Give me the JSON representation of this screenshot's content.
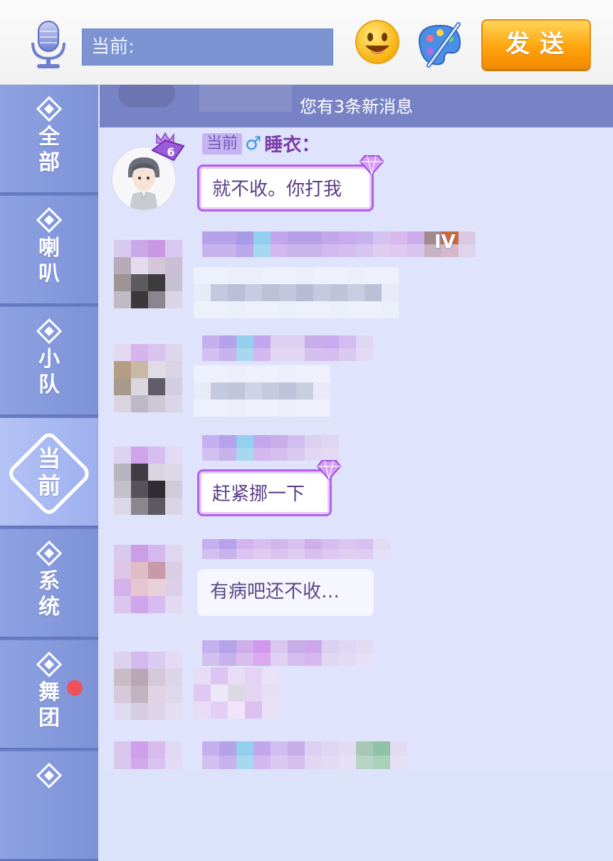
{
  "topbar": {
    "input_prefix": "当前:",
    "send_label": "发送",
    "icons": [
      "microphone-icon",
      "emoji-icon",
      "palette-icon"
    ]
  },
  "sidebar": {
    "tabs": [
      {
        "label": "全部",
        "id": "all"
      },
      {
        "label": "喇叭",
        "id": "horn"
      },
      {
        "label": "小队",
        "id": "team"
      },
      {
        "label": "当前",
        "id": "current",
        "active": true
      },
      {
        "label": "系统",
        "id": "system"
      },
      {
        "label": "舞团",
        "id": "dance",
        "badge": true
      }
    ]
  },
  "chat": {
    "new_messages_banner": "您有3条新消息",
    "messages": [
      {
        "channel": "当前",
        "gender": "♂",
        "username": "睡衣",
        "colon": "：",
        "text": "就不收。你打我",
        "vip_level": "6"
      },
      {
        "text": "赶紧挪一下"
      },
      {
        "text": "有病吧还不收…"
      }
    ],
    "badge_text": "IV"
  },
  "colors": {
    "accent": "#7b3aa8",
    "sidebar": "#8ea2e2",
    "chat_bg": "#dfe3fc",
    "send_button": "#ffa50d",
    "banner": "#7883c5"
  }
}
